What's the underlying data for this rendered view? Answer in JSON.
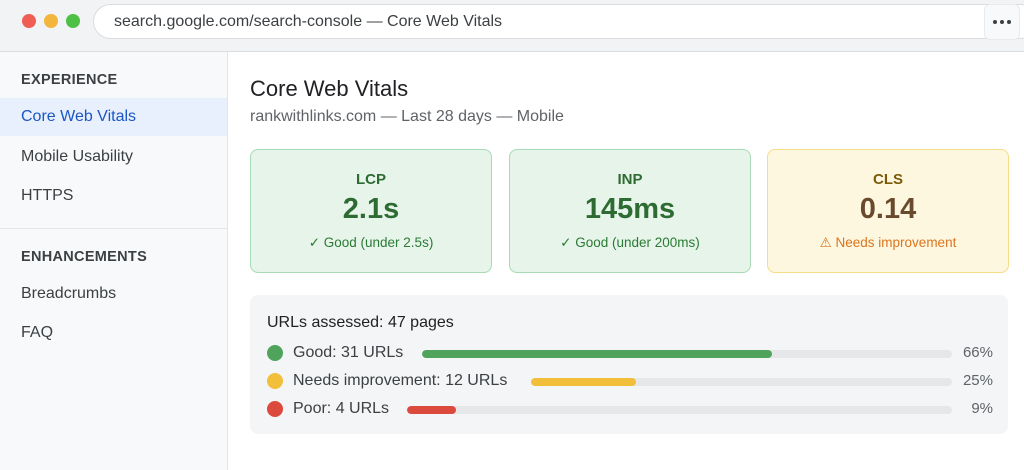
{
  "browser": {
    "url": "search.google.com/search-console — Core Web Vitals",
    "menu_icon": "more-horizontal-icon"
  },
  "sidebar": {
    "sections": [
      {
        "title": "EXPERIENCE",
        "items": [
          {
            "label": "Core Web Vitals",
            "active": true
          },
          {
            "label": "Mobile Usability",
            "active": false
          },
          {
            "label": "HTTPS",
            "active": false
          }
        ]
      },
      {
        "title": "ENHANCEMENTS",
        "items": [
          {
            "label": "Breadcrumbs",
            "active": false
          },
          {
            "label": "FAQ",
            "active": false
          }
        ]
      }
    ]
  },
  "main": {
    "title": "Core Web Vitals",
    "subtitle": "rankwithlinks.com — Last 28 days — Mobile",
    "metrics": [
      {
        "label": "LCP",
        "value": "2.1s",
        "status": "✓ Good (under 2.5s)",
        "state": "good"
      },
      {
        "label": "INP",
        "value": "145ms",
        "status": "✓ Good (under 200ms)",
        "state": "good"
      },
      {
        "label": "CLS",
        "value": "0.14",
        "status": "⚠ Needs improvement",
        "state": "warn"
      }
    ],
    "distribution": {
      "title": "URLs assessed: 47 pages",
      "rows": [
        {
          "label": "Good: 31 URLs",
          "percent_label": "66%",
          "percent": 66,
          "color": "#4fa35a"
        },
        {
          "label": "Needs improvement: 12 URLs",
          "percent_label": "25%",
          "percent": 25,
          "color": "#f2bf3a"
        },
        {
          "label": "Poor: 4 URLs",
          "percent_label": "9%",
          "percent": 9,
          "color": "#dc4a3d"
        }
      ]
    }
  },
  "colors": {
    "accent": "#1a56c4",
    "good": "#2e6b33",
    "warn": "#d9751e",
    "poor": "#dc4a3d"
  }
}
